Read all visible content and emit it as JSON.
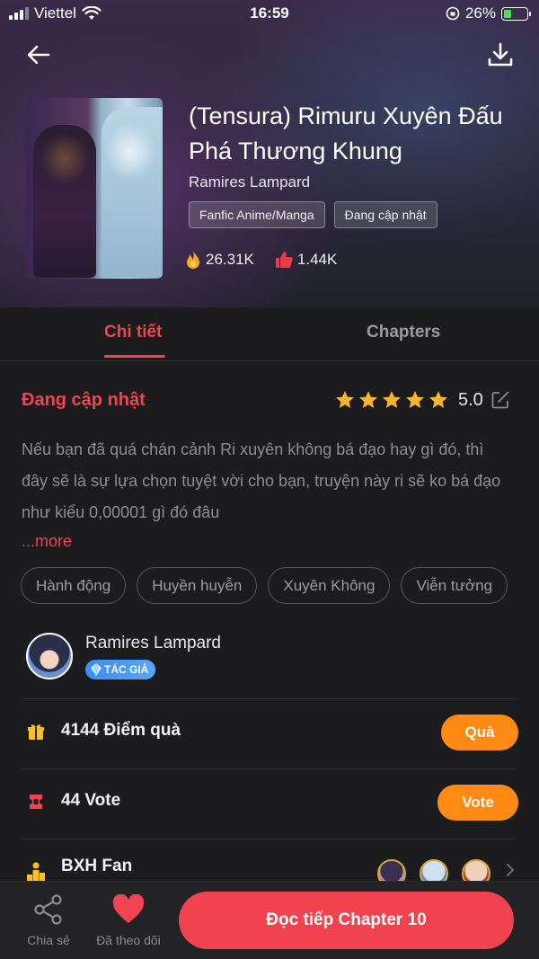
{
  "status_bar": {
    "carrier": "Viettel",
    "time": "16:59",
    "battery": "26%",
    "battery_level": 0.26
  },
  "header": {
    "title": "(Tensura) Rimuru Xuyên Đấu Phá Thương Khung",
    "author": "Ramires Lampard",
    "tags": [
      "Fanfic Anime/Manga",
      "Đang cập nhật"
    ],
    "views": "26.31K",
    "likes": "1.44K"
  },
  "tabs": [
    {
      "label": "Chi tiết",
      "active": true
    },
    {
      "label": "Chapters",
      "active": false
    }
  ],
  "detail": {
    "status": "Đang cập nhật",
    "rating": "5.0",
    "rating_stars": 5,
    "description": "Nếu bạn đã quá chán cảnh Ri xuyên không bá đạo hay gì đó, thì đây sẽ là sự lựa chọn tuyệt vời cho bạn, truyện này ri sẽ ko bá đạo như kiểu 0,00001 gì đó đâu",
    "more_label": "...more",
    "genres": [
      "Hành động",
      "Huyền huyễn",
      "Xuyên Không",
      "Viễn tưởng"
    ]
  },
  "author_card": {
    "name": "Ramires Lampard",
    "badge": "TÁC GIẢ"
  },
  "gift_row": {
    "label": "4144 Điểm quà",
    "button": "Quà"
  },
  "vote_row": {
    "label": "44 Vote",
    "button": "Vote"
  },
  "fan_row": {
    "label": "BXH Fan"
  },
  "bottom_bar": {
    "share_label": "Chia sẻ",
    "follow_label": "Đã theo dõi",
    "read_label": "Đọc tiếp Chapter 10"
  },
  "colors": {
    "accent": "#ef4452",
    "orange": "#ff8a14",
    "star": "#f7b52c"
  }
}
